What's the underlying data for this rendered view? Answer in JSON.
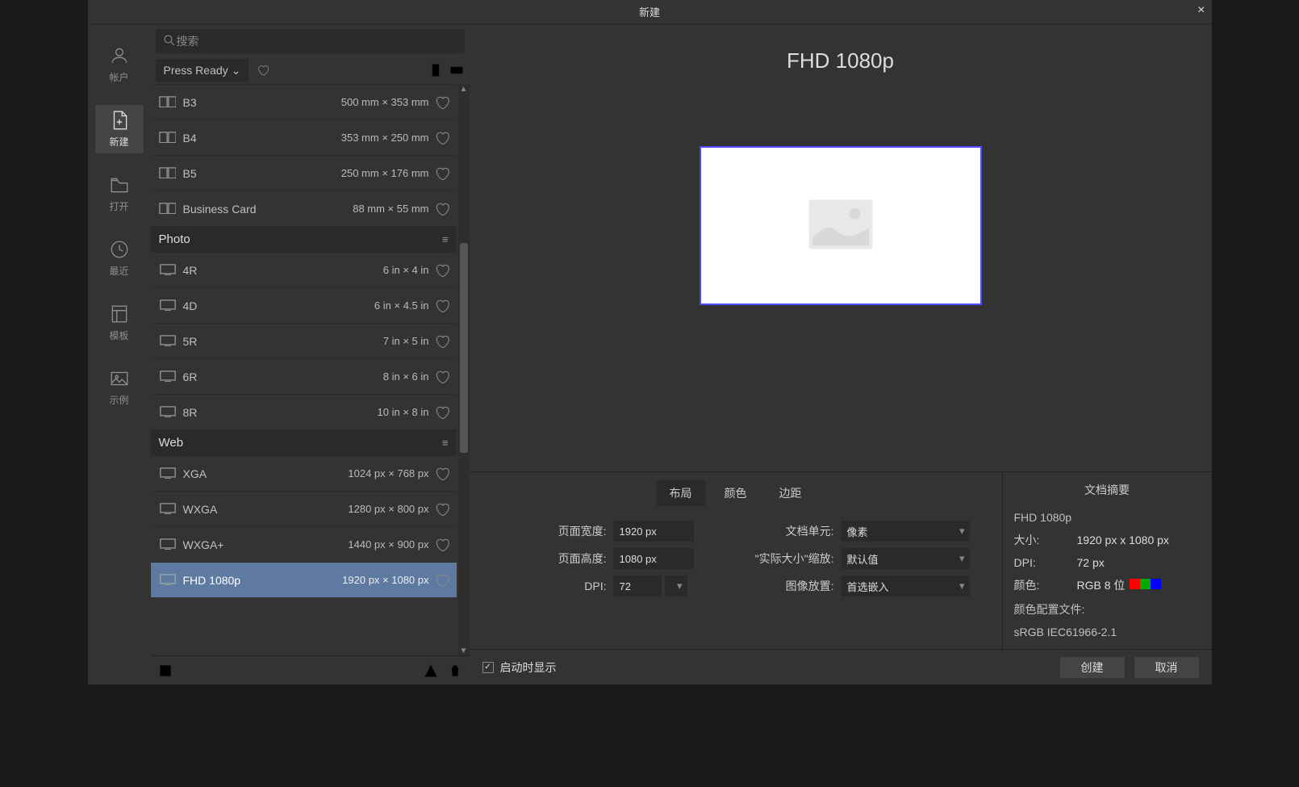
{
  "titlebar": {
    "title": "新建"
  },
  "sidebar": {
    "items": [
      {
        "label": "帐户",
        "id": "account"
      },
      {
        "label": "新建",
        "id": "new"
      },
      {
        "label": "打开",
        "id": "open"
      },
      {
        "label": "最近",
        "id": "recent"
      },
      {
        "label": "模板",
        "id": "templates"
      },
      {
        "label": "示例",
        "id": "samples"
      }
    ]
  },
  "search": {
    "placeholder": "搜索"
  },
  "filter": {
    "selected": "Press Ready"
  },
  "groups": [
    {
      "name": "",
      "items": [
        {
          "name": "B3",
          "dim": "500 mm × 353 mm",
          "type": "spread"
        },
        {
          "name": "B4",
          "dim": "353 mm × 250 mm",
          "type": "spread"
        },
        {
          "name": "B5",
          "dim": "250 mm × 176 mm",
          "type": "spread"
        },
        {
          "name": "Business Card",
          "dim": "88 mm × 55 mm",
          "type": "spread"
        }
      ]
    },
    {
      "name": "Photo",
      "items": [
        {
          "name": "4R",
          "dim": "6 in × 4 in",
          "type": "screen"
        },
        {
          "name": "4D",
          "dim": "6 in × 4.5 in",
          "type": "screen"
        },
        {
          "name": "5R",
          "dim": "7 in × 5 in",
          "type": "screen"
        },
        {
          "name": "6R",
          "dim": "8 in × 6 in",
          "type": "screen"
        },
        {
          "name": "8R",
          "dim": "10 in × 8 in",
          "type": "screen"
        }
      ]
    },
    {
      "name": "Web",
      "items": [
        {
          "name": "XGA",
          "dim": "1024 px × 768 px",
          "type": "screen"
        },
        {
          "name": "WXGA",
          "dim": "1280 px × 800 px",
          "type": "screen"
        },
        {
          "name": "WXGA+",
          "dim": "1440 px × 900 px",
          "type": "screen"
        },
        {
          "name": "FHD 1080p",
          "dim": "1920 px × 1080 px",
          "type": "screen",
          "selected": true
        }
      ]
    }
  ],
  "previewTitle": "FHD 1080p",
  "tabs": {
    "layout": "布局",
    "color": "颜色",
    "margins": "边距"
  },
  "form": {
    "widthLabel": "页面宽度:",
    "widthValue": "1920 px",
    "heightLabel": "页面高度:",
    "heightValue": "1080 px",
    "dpiLabel": "DPI:",
    "dpiValue": "72",
    "unitsLabel": "文档单元:",
    "unitsValue": "像素",
    "scaleLabel": "\"实际大小\"缩放:",
    "scaleValue": "默认值",
    "imageLabel": "图像放置:",
    "imageValue": "首选嵌入"
  },
  "summary": {
    "title": "文档摘要",
    "name": "FHD 1080p",
    "sizeLabel": "大小:",
    "sizeValue": "1920 px  x  1080 px",
    "dpiLabel": "DPI:",
    "dpiValue": "72 px",
    "colorLabel": "颜色:",
    "colorValue": "RGB 8 位",
    "profileLabel": "颜色配置文件:",
    "profileValue": "sRGB IEC61966-2.1",
    "swatches": [
      "#ff0000",
      "#00aa00",
      "#0000ff"
    ]
  },
  "footer": {
    "showOnStart": "启动时显示",
    "create": "创建",
    "cancel": "取消"
  }
}
